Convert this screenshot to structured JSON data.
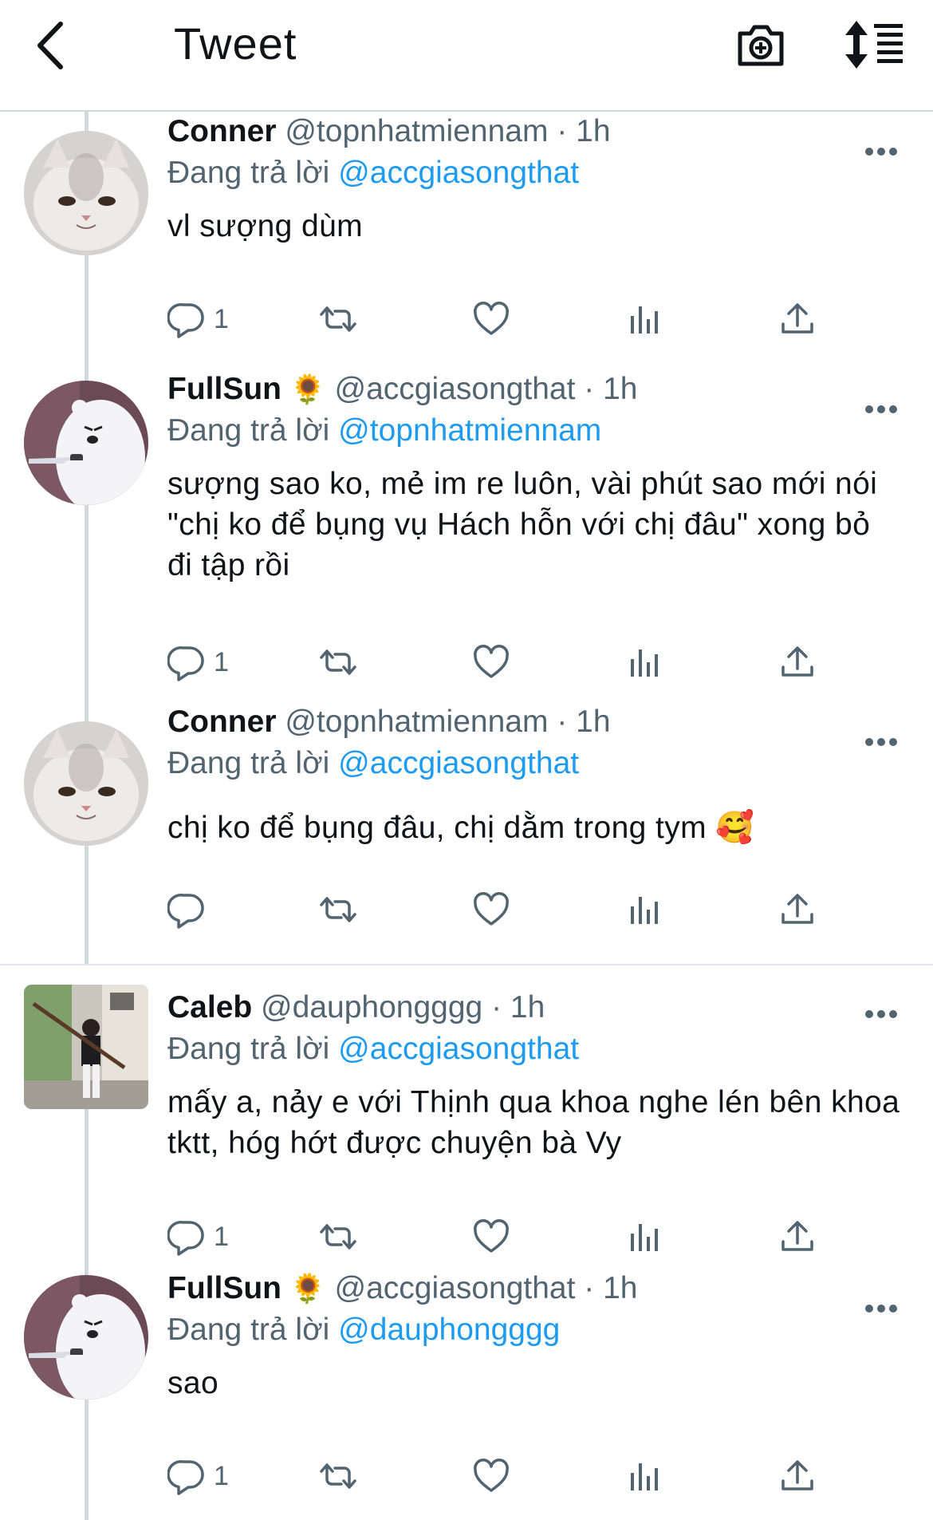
{
  "header": {
    "title": "Tweet",
    "back_icon": "chevron-left-icon",
    "camera_icon": "camera-add-icon",
    "sort_icon": "sort-order-icon"
  },
  "colors": {
    "link": "#1d9bf0",
    "secondary_text": "#536471",
    "primary_text": "#0f1419",
    "thread_line": "#cfd9de"
  },
  "reply_prefix": "Đang trả lời",
  "tweets": [
    {
      "name": "Conner",
      "emoji": "",
      "handle": "@topnhatmiennam",
      "time": "· 1h",
      "reply_to": "@accgiasongthat",
      "text": "vl sượng dùm",
      "reply_count": "1",
      "avatar": "white-cat-avatar"
    },
    {
      "name": "FullSun",
      "emoji": "🌻",
      "handle": "@accgiasongthat",
      "time": "· 1h",
      "reply_to": "@topnhatmiennam",
      "text": "sượng sao ko, mẻ im re luôn, vài phút sao mới nói \"chị ko để bụng vụ Hách hỗn với chị đâu\" xong bỏ đi tập rồi",
      "reply_count": "1",
      "avatar": "polar-bear-knife-avatar"
    },
    {
      "name": "Conner",
      "emoji": "",
      "handle": "@topnhatmiennam",
      "time": "· 1h",
      "reply_to": "@accgiasongthat",
      "text": "chị ko để bụng đâu, chị dằm trong tym 🥰",
      "reply_count": "",
      "avatar": "white-cat-avatar"
    },
    {
      "name": "Caleb",
      "emoji": "",
      "handle": "@dauphongggg",
      "time": "· 1h",
      "reply_to": "@accgiasongthat",
      "text": "mấy a, nảy e với Thịnh qua khoa nghe lén bên khoa tktt, hóg hớt được chuyện bà Vy",
      "reply_count": "1",
      "avatar": "boy-photo-avatar"
    },
    {
      "name": "FullSun",
      "emoji": "🌻",
      "handle": "@accgiasongthat",
      "time": "· 1h",
      "reply_to": "@dauphongggg",
      "text": "sao",
      "reply_count": "1",
      "avatar": "polar-bear-knife-avatar"
    }
  ]
}
